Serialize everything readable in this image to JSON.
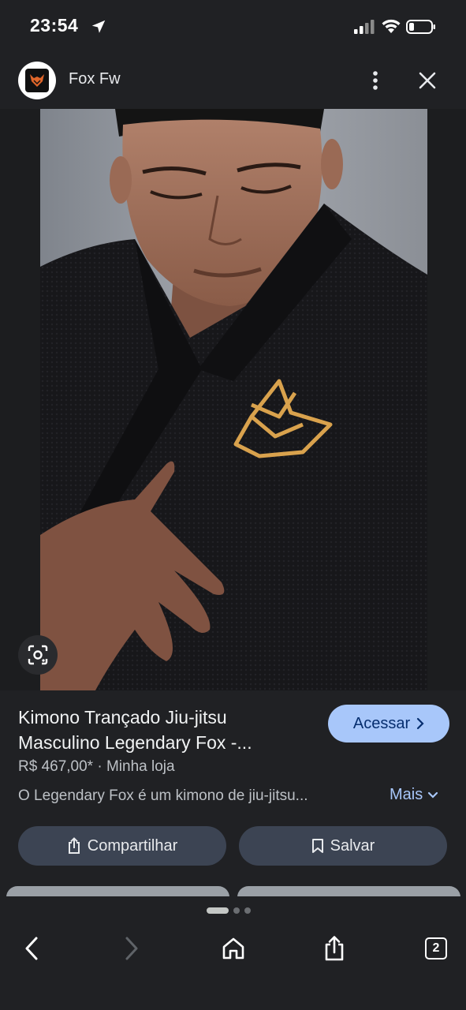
{
  "status_bar": {
    "time": "23:54",
    "icons": [
      "location-arrow-icon",
      "signal-icon",
      "wifi-icon",
      "battery-icon"
    ]
  },
  "header": {
    "site_name": "Fox Fw",
    "logo": "fox-logo-icon",
    "menu_icon": "more-vert-icon",
    "close_icon": "close-icon"
  },
  "image": {
    "description_icon": "lens-icon",
    "logo_color": "#d9a24d"
  },
  "product": {
    "title_line1": "Kimono Trançado Jiu-jitsu",
    "title_line2": "Masculino Legendary Fox -...",
    "price": "R$ 467,00*",
    "separator": "·",
    "store": "Minha loja",
    "description": "O Legendary Fox é um kimono de jiu-jitsu...",
    "more_label": "Mais",
    "visit_label": "Acessar",
    "share_label": "Compartilhar",
    "save_label": "Salvar"
  },
  "bottom_nav": {
    "tab_count": "2",
    "icons": [
      "back-icon",
      "forward-icon",
      "home-icon",
      "share-icon",
      "tabs-icon"
    ]
  },
  "colors": {
    "background": "#202124",
    "accent": "#a8c7fa",
    "button_bg": "#3c4453"
  }
}
